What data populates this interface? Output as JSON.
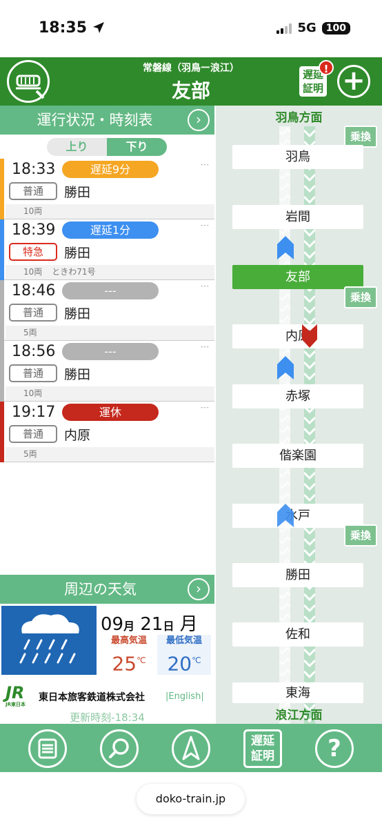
{
  "status_bar": {
    "time": "18:35",
    "network": "5G",
    "battery": "100"
  },
  "header": {
    "line": "常磐線（羽鳥ー浪江）",
    "station": "友部",
    "proof_label_1": "遅延",
    "proof_label_2": "証明",
    "badge": "!",
    "plus": "+"
  },
  "timetable": {
    "title": "運行状況・時刻表",
    "tab_up": "上り",
    "tab_down": "下り",
    "trains": [
      {
        "time": "18:33",
        "status": "遅延9分",
        "type": "普通",
        "dest": "勝田",
        "cars": "10両",
        "name": "",
        "dash": "---"
      },
      {
        "time": "18:39",
        "status": "遅延1分",
        "type": "特急",
        "dest": "勝田",
        "cars": "10両",
        "name": "ときわ71号",
        "dash": "---"
      },
      {
        "time": "18:46",
        "status": "---",
        "type": "普通",
        "dest": "勝田",
        "cars": "5両",
        "name": "",
        "dash": "---"
      },
      {
        "time": "18:56",
        "status": "---",
        "type": "普通",
        "dest": "勝田",
        "cars": "10両",
        "name": "",
        "dash": "---"
      },
      {
        "time": "19:17",
        "status": "運休",
        "type": "普通",
        "dest": "内原",
        "cars": "5両",
        "name": "",
        "dash": "---"
      }
    ]
  },
  "weather": {
    "title": "周辺の天気",
    "month": "09",
    "month_unit": "月",
    "day": "21",
    "day_unit": "日",
    "weekday": "月",
    "high_label": "最高気温",
    "high": "25",
    "low_label": "最低気温",
    "low": "20",
    "unit": "℃"
  },
  "footer": {
    "jr": "JR",
    "jr_sub": "JR東日本",
    "company": "東日本旅客鉄道株式会社",
    "english": "|English|",
    "updated": "更新時刻-18:34"
  },
  "route": {
    "top_direction": "羽鳥方面",
    "bottom_direction": "浪江方面",
    "transfer_label": "乗換",
    "stations": [
      "羽鳥",
      "岩間",
      "友部",
      "内原",
      "赤塚",
      "偕楽園",
      "水戸",
      "勝田",
      "佐和",
      "東海"
    ]
  },
  "nav": {
    "proof_1": "遅延",
    "proof_2": "証明",
    "help": "?"
  },
  "browser": {
    "url": "doko-train.jp"
  },
  "colors": {
    "green_dark": "#2f8a2b",
    "green_light": "#63b985",
    "orange": "#f5a623",
    "blue": "#3d8ff0",
    "gray": "#b3b3b3",
    "red": "#c5281c"
  }
}
